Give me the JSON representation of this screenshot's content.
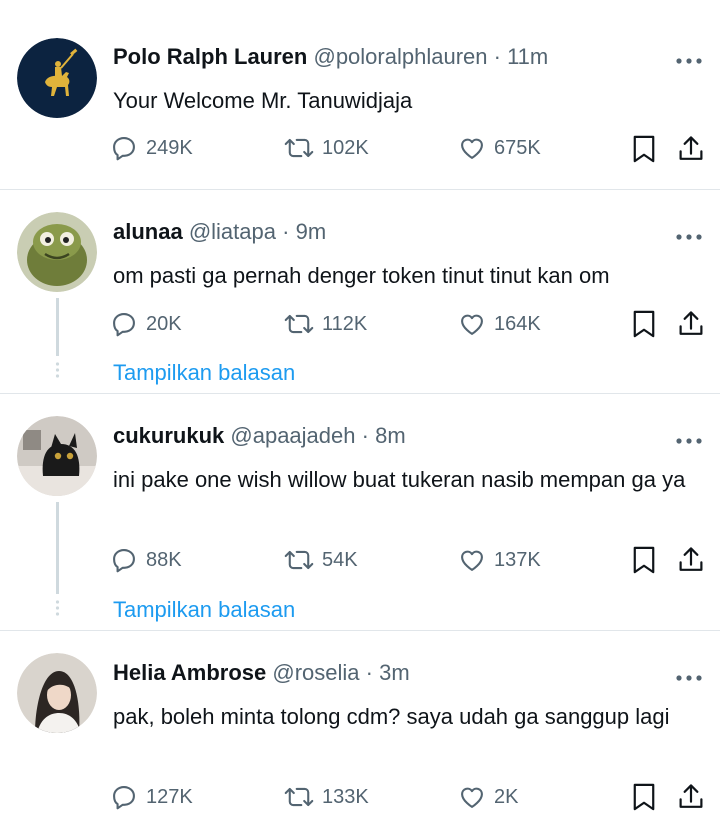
{
  "tweets": [
    {
      "name": "Polo Ralph Lauren",
      "handle": "@poloralphlauren",
      "dot": "·",
      "time": "11m",
      "text": "Your Welcome Mr. Tanuwidjaja",
      "replies": "249K",
      "retweets": "102K",
      "likes": "675K",
      "avatar_icon": "polo-logo-icon"
    },
    {
      "name": "alunaa",
      "handle": "@liatapa",
      "dot": "·",
      "time": "9m",
      "text": "om pasti ga pernah denger token tinut tinut kan om",
      "replies": "20K",
      "retweets": "112K",
      "likes": "164K",
      "show_replies": "Tampilkan balasan"
    },
    {
      "name": "cukurukuk",
      "handle": "@apaajadeh",
      "dot": "·",
      "time": "8m",
      "text": "ini pake one wish willow buat tukeran nasib mempan ga ya",
      "replies": "88K",
      "retweets": "54K",
      "likes": "137K",
      "show_replies": "Tampilkan balasan"
    },
    {
      "name": "Helia Ambrose",
      "handle": "@roselia",
      "dot": "·",
      "time": "3m",
      "text": "pak, boleh minta tolong cdm? saya udah ga sanggup lagi",
      "replies": "127K",
      "retweets": "133K",
      "likes": "2K"
    }
  ],
  "colors": {
    "link": "#1d9bf0",
    "muted": "#536471",
    "text": "#0f1419",
    "separator": "#e1e6ea",
    "polo_navy": "#0c2340",
    "polo_gold": "#e0b33b"
  }
}
